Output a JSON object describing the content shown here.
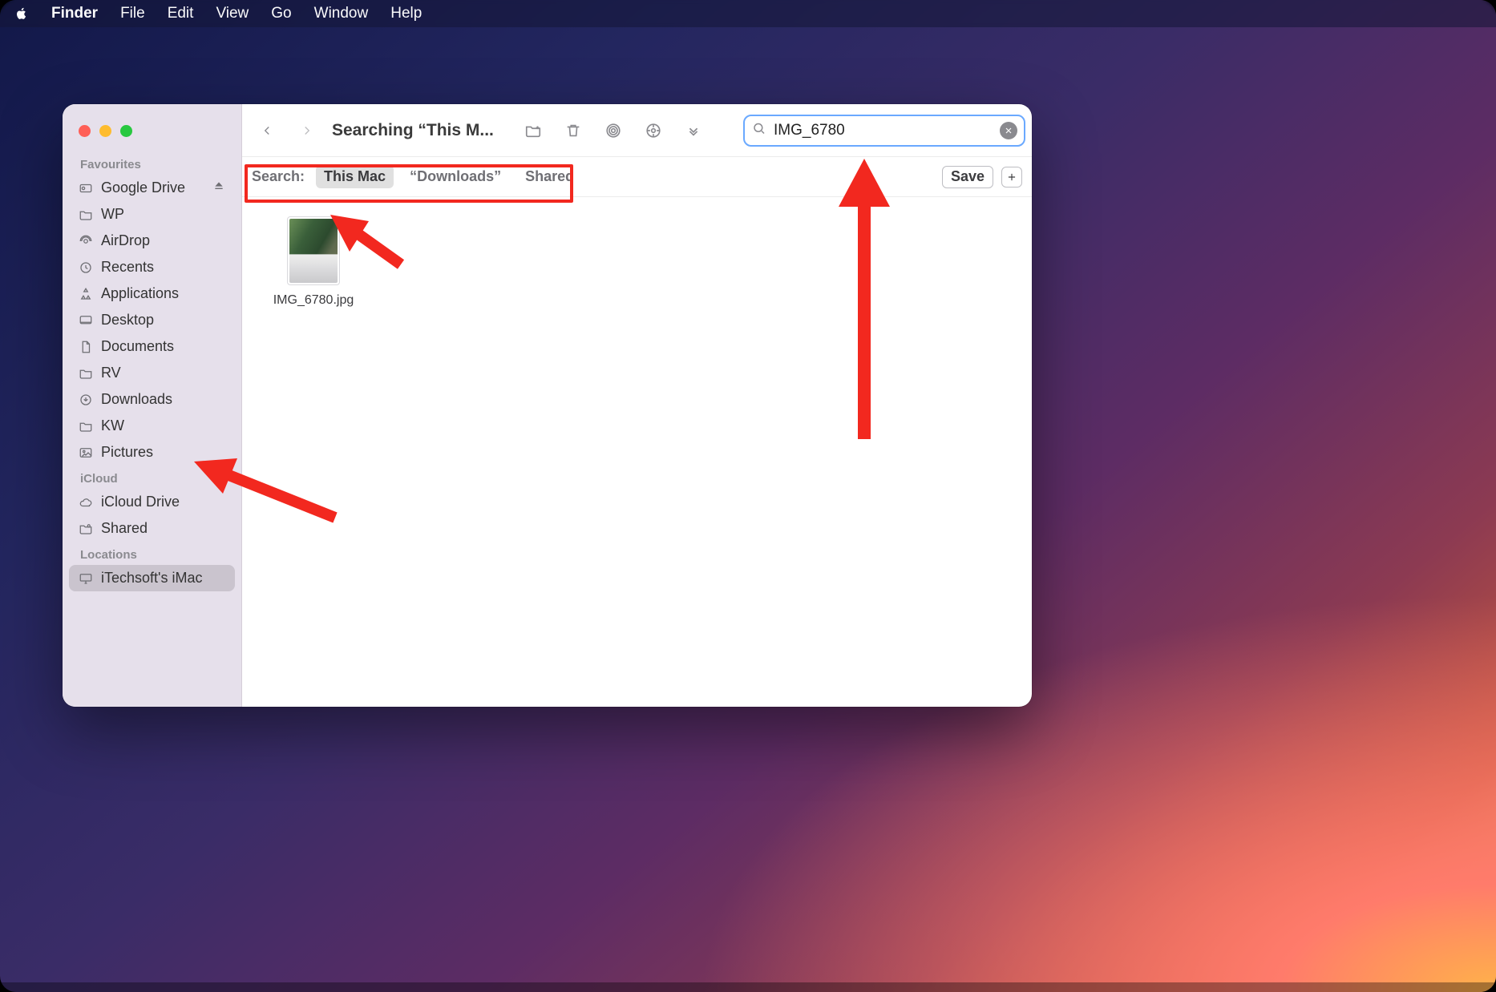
{
  "menubar": {
    "app": "Finder",
    "items": [
      "File",
      "Edit",
      "View",
      "Go",
      "Window",
      "Help"
    ]
  },
  "window": {
    "title": "Searching “This M...",
    "search": {
      "value": "IMG_6780",
      "icon": "search-icon"
    }
  },
  "scope": {
    "label": "Search:",
    "options": [
      {
        "label": "This Mac",
        "selected": true
      },
      {
        "label": "“Downloads”",
        "selected": false
      },
      {
        "label": "Shared",
        "selected": false
      }
    ],
    "save_label": "Save"
  },
  "sidebar": {
    "sections": [
      {
        "title": "Favourites",
        "items": [
          {
            "icon": "google-drive-icon",
            "label": "Google Drive",
            "eject": true
          },
          {
            "icon": "folder-icon",
            "label": "WP"
          },
          {
            "icon": "airdrop-icon",
            "label": "AirDrop"
          },
          {
            "icon": "clock-icon",
            "label": "Recents"
          },
          {
            "icon": "apps-icon",
            "label": "Applications"
          },
          {
            "icon": "desktop-icon",
            "label": "Desktop"
          },
          {
            "icon": "doc-icon",
            "label": "Documents"
          },
          {
            "icon": "folder-icon",
            "label": "RV"
          },
          {
            "icon": "download-icon",
            "label": "Downloads"
          },
          {
            "icon": "folder-icon",
            "label": "KW"
          },
          {
            "icon": "image-icon",
            "label": "Pictures"
          }
        ]
      },
      {
        "title": "iCloud",
        "items": [
          {
            "icon": "cloud-icon",
            "label": "iCloud Drive"
          },
          {
            "icon": "shared-folder-icon",
            "label": "Shared"
          }
        ]
      },
      {
        "title": "Locations",
        "items": [
          {
            "icon": "imac-icon",
            "label": "iTechsoft's iMac",
            "selected": true
          }
        ]
      }
    ]
  },
  "files": [
    {
      "name": "IMG_6780.jpg"
    }
  ],
  "annotations": {
    "arrows": [
      "to-downloads",
      "to-file",
      "to-search"
    ],
    "boxes": [
      "scope-highlight"
    ]
  }
}
